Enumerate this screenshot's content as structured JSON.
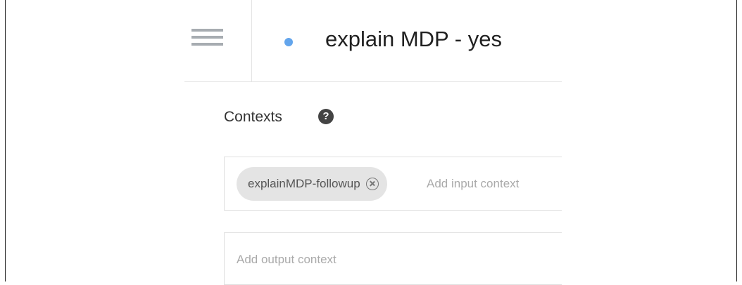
{
  "header": {
    "title": "explain MDP - yes",
    "status_color": "#63a5ec"
  },
  "contexts": {
    "label": "Contexts",
    "help_icon": "help-circle-icon",
    "input": {
      "chips": [
        {
          "label": "explainMDP-followup"
        }
      ],
      "placeholder": "Add input context"
    },
    "output": {
      "placeholder": "Add output context"
    }
  }
}
